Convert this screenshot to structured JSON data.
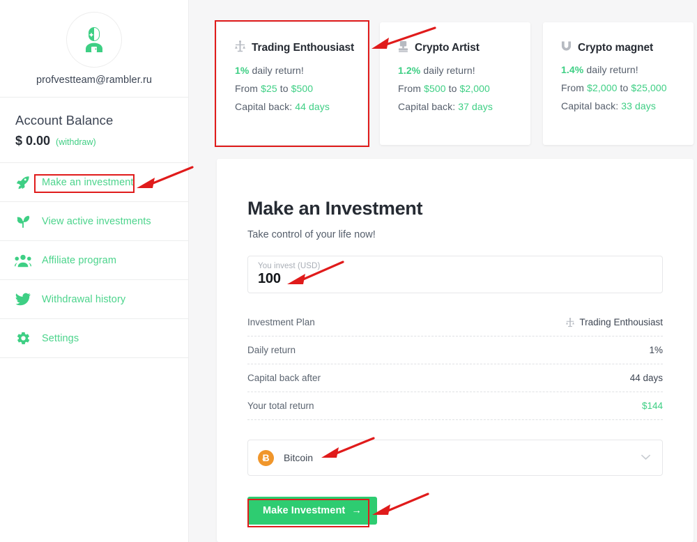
{
  "sidebar": {
    "avatar_icon": "astronaut-avatar-icon",
    "email": "profvestteam@rambler.ru",
    "balance": {
      "title": "Account Balance",
      "amount": "$ 0.00",
      "withdraw_label": "(withdraw)"
    },
    "items": [
      {
        "label": "Make an investment",
        "icon": "rocket-icon"
      },
      {
        "label": "View active investments",
        "icon": "sprout-icon"
      },
      {
        "label": "Affiliate program",
        "icon": "people-icon"
      },
      {
        "label": "Withdrawal history",
        "icon": "bird-icon"
      },
      {
        "label": "Settings",
        "icon": "gear-icon"
      }
    ]
  },
  "plans": [
    {
      "icon": "trading-scale-icon",
      "name": "Trading Enthousiast",
      "rate": "1%",
      "rate_suffix": "daily return!",
      "range_prefix": "From",
      "range_min": "$25",
      "range_mid": "to",
      "range_max": "$500",
      "capital_label": "Capital back:",
      "capital_value": "44 days"
    },
    {
      "icon": "stamp-icon",
      "name": "Crypto Artist",
      "rate": "1.2%",
      "rate_suffix": "daily return!",
      "range_prefix": "From",
      "range_min": "$500",
      "range_mid": "to",
      "range_max": "$2,000",
      "capital_label": "Capital back:",
      "capital_value": "37 days"
    },
    {
      "icon": "magnet-icon",
      "name": "Crypto magnet",
      "rate": "1.4%",
      "rate_suffix": "daily return!",
      "range_prefix": "From",
      "range_min": "$2,000",
      "range_mid": "to",
      "range_max": "$25,000",
      "capital_label": "Capital back:",
      "capital_value": "33 days"
    }
  ],
  "form": {
    "title": "Make an Investment",
    "subtitle": "Take control of your life now!",
    "amount_label": "You invest (USD)",
    "amount_value": "100",
    "summary": [
      {
        "key": "Investment Plan",
        "value": "Trading Enthousiast",
        "icon": "trading-scale-icon",
        "green": false
      },
      {
        "key": "Daily return",
        "value": "1%",
        "icon": "",
        "green": false
      },
      {
        "key": "Capital back after",
        "value": "44 days",
        "icon": "",
        "green": false
      },
      {
        "key": "Your total return",
        "value": "$144",
        "icon": "",
        "green": true
      }
    ],
    "payment": {
      "coin_symbol": "Ƀ",
      "coin_icon": "bitcoin-icon",
      "label": "Bitcoin",
      "chevron_icon": "chevron-down-icon"
    },
    "cta_label": "Make Investment",
    "cta_arrow": "→"
  },
  "colors": {
    "accent_green": "#3ecf84",
    "button_green": "#2ecc71",
    "annotation_red": "#e01b1b",
    "bitcoin_orange": "#f0962b"
  }
}
